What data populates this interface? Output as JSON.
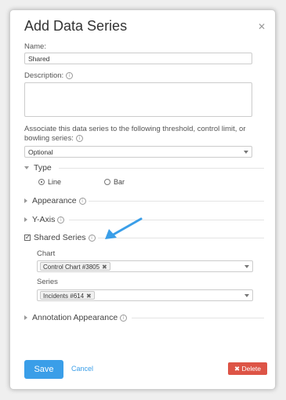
{
  "dialog": {
    "title": "Add Data Series",
    "close_icon": "close-icon"
  },
  "name": {
    "label": "Name:",
    "value": "Shared"
  },
  "description": {
    "label": "Description:",
    "value": ""
  },
  "association": {
    "label_line1": "Associate this data series to the following threshold, control limit, or",
    "label_line2": "bowling series:",
    "selected": "Optional"
  },
  "type": {
    "label": "Type",
    "options": [
      {
        "label": "Line",
        "selected": true
      },
      {
        "label": "Bar",
        "selected": false
      }
    ]
  },
  "appearance": {
    "label": "Appearance"
  },
  "y_axis": {
    "label": "Y-Axis"
  },
  "shared_series": {
    "label": "Shared Series",
    "checked": true,
    "chart_label": "Chart",
    "chart_tag": "Control Chart #3805",
    "series_label": "Series",
    "series_tag": "Incidents #614"
  },
  "annotation_appearance": {
    "label": "Annotation Appearance"
  },
  "footer": {
    "save_label": "Save",
    "cancel_label": "Cancel",
    "delete_label": "Delete"
  },
  "colors": {
    "primary": "#3a9ee8",
    "danger": "#dd5446",
    "annotation_arrow": "#3a9ee8"
  }
}
